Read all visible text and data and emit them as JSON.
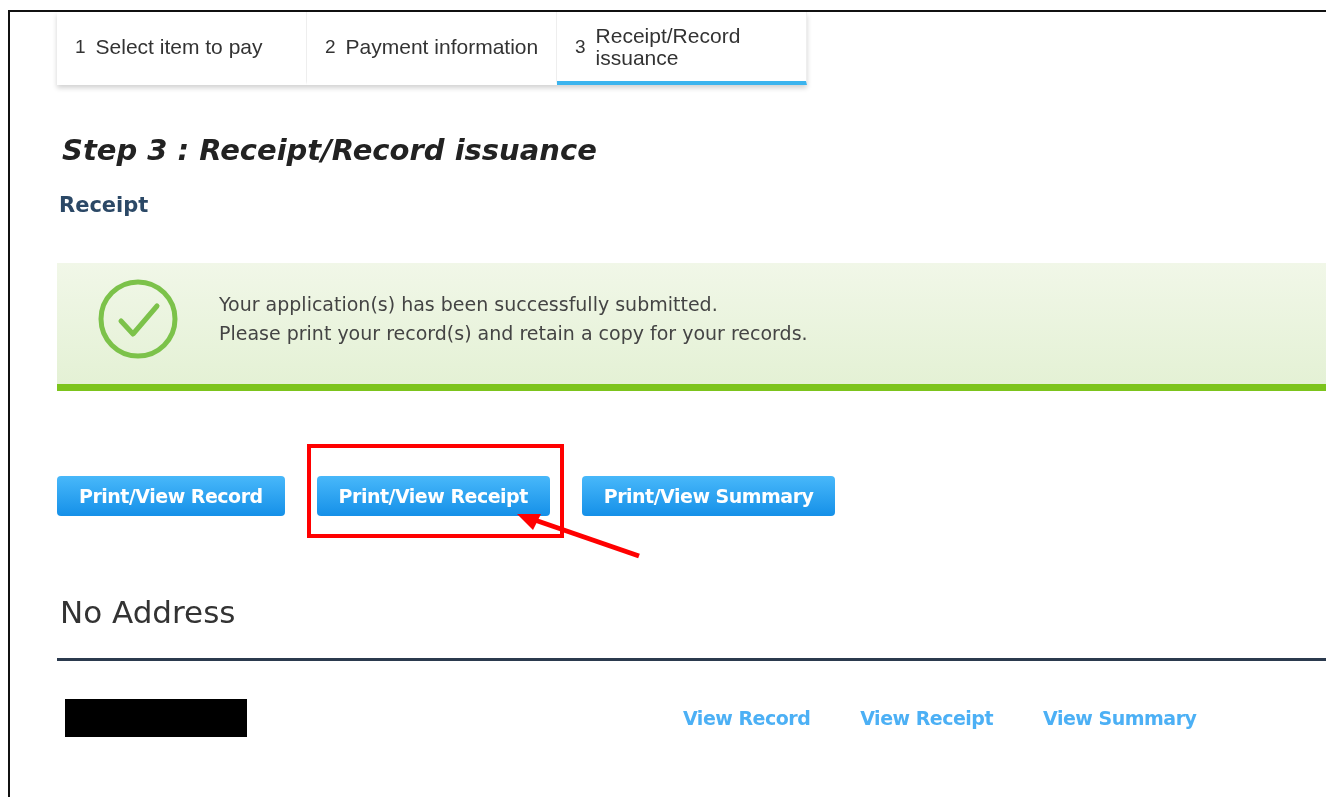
{
  "steps": [
    {
      "number": "1",
      "label": "Select item to pay",
      "selected": false
    },
    {
      "number": "2",
      "label": "Payment information",
      "selected": false
    },
    {
      "number": "3",
      "label": "Receipt/Record issuance",
      "selected": true
    }
  ],
  "heading": "Step 3 : Receipt/Record issuance",
  "section_title": "Receipt",
  "success_message": {
    "lines": [
      "Your application(s) has been successfully submitted.",
      "Please print your record(s) and retain a copy for your records."
    ]
  },
  "buttons": [
    {
      "label": "Print/View Record",
      "highlighted": false
    },
    {
      "label": "Print/View Receipt",
      "highlighted": true
    },
    {
      "label": "Print/View Summary",
      "highlighted": false
    }
  ],
  "address_title": "No Address",
  "record_links": [
    "View Record",
    "View Receipt",
    "View Summary"
  ]
}
